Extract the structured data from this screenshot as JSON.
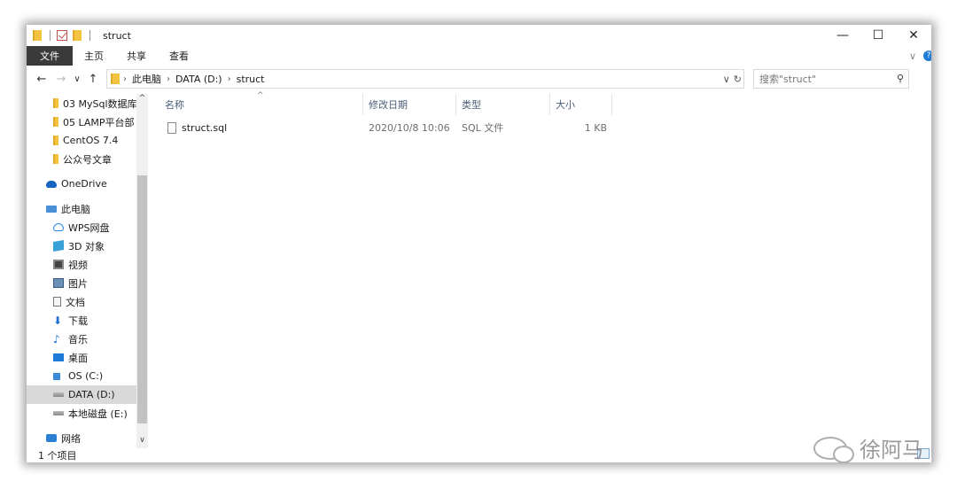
{
  "window": {
    "title": "struct"
  },
  "window_controls": {
    "minimize": "—",
    "maximize": "☐",
    "close": "✕"
  },
  "ribbon": {
    "tabs": [
      "文件",
      "主页",
      "共享",
      "查看"
    ],
    "collapse_glyph": "∨",
    "help_glyph": "?"
  },
  "nav": {
    "back": "←",
    "forward": "→",
    "recent": "∨",
    "up": "↑"
  },
  "address": {
    "crumbs": [
      "此电脑",
      "DATA (D:)",
      "struct"
    ],
    "sep": "›",
    "dropdown": "∨",
    "refresh": "↻"
  },
  "search": {
    "placeholder": "搜索\"struct\"",
    "icon": "⚲"
  },
  "navpane": {
    "items": [
      {
        "label": "03 MySql数据库",
        "icon": "folder-icon"
      },
      {
        "label": "05 LAMP平台部",
        "icon": "folder-icon"
      },
      {
        "label": "CentOS 7.4",
        "icon": "folder-icon"
      },
      {
        "label": "公众号文章",
        "icon": "folder-icon"
      },
      {
        "label": "OneDrive",
        "icon": "onedrive-icon"
      },
      {
        "label": "此电脑",
        "icon": "computer-icon"
      },
      {
        "label": "WPS网盘",
        "icon": "wps-cloud-icon"
      },
      {
        "label": "3D 对象",
        "icon": "3d-objects-icon"
      },
      {
        "label": "视频",
        "icon": "video-icon"
      },
      {
        "label": "图片",
        "icon": "pictures-icon"
      },
      {
        "label": "文档",
        "icon": "documents-icon"
      },
      {
        "label": "下载",
        "icon": "download-icon"
      },
      {
        "label": "音乐",
        "icon": "music-icon"
      },
      {
        "label": "桌面",
        "icon": "desktop-icon"
      },
      {
        "label": "OS (C:)",
        "icon": "os-drive-icon"
      },
      {
        "label": "DATA (D:)",
        "icon": "drive-icon"
      },
      {
        "label": "本地磁盘 (E:)",
        "icon": "drive-icon"
      },
      {
        "label": "网络",
        "icon": "network-icon"
      }
    ],
    "selected": "DATA (D:)",
    "scroll_up": "^",
    "scroll_down": "∨"
  },
  "filelist": {
    "columns": [
      "名称",
      "修改日期",
      "类型",
      "大小"
    ],
    "sort_indicator": "^",
    "rows": [
      {
        "name": "struct.sql",
        "modified": "2020/10/8 10:06",
        "type": "SQL 文件",
        "size": "1 KB"
      }
    ]
  },
  "statusbar": {
    "text": "1 个项目"
  },
  "watermark": {
    "text": "徐阿马"
  }
}
